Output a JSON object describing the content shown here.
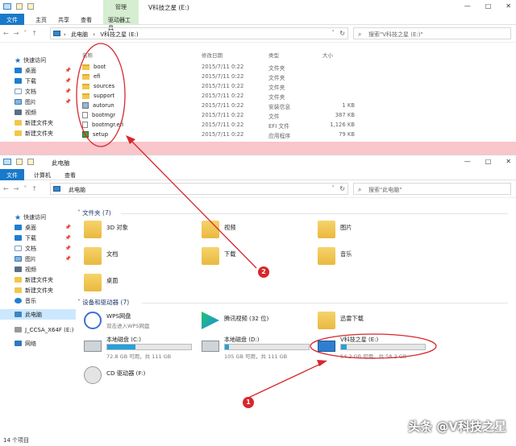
{
  "window1": {
    "context_tab": "管理",
    "title": "V科技之星 (E:)",
    "ribbon": {
      "file": "文件",
      "home": "主页",
      "share": "共享",
      "view": "查看",
      "drive_tools": "驱动器工具"
    },
    "address": {
      "pc": "此电脑",
      "sep": "›",
      "drive": "V科技之星 (E:)"
    },
    "search_placeholder": "搜索\"V科技之星 (E:)\"",
    "sidebar": [
      {
        "label": "快速访问",
        "icon": "star-icon"
      },
      {
        "label": "桌面",
        "icon": "desktop-icon",
        "pinned": true
      },
      {
        "label": "下载",
        "icon": "download-icon",
        "pinned": true
      },
      {
        "label": "文档",
        "icon": "documents-icon",
        "pinned": true
      },
      {
        "label": "图片",
        "icon": "pictures-icon",
        "pinned": true
      },
      {
        "label": "视频",
        "icon": "videos-icon"
      },
      {
        "label": "新建文件夹",
        "icon": "folder-icon"
      },
      {
        "label": "新建文件夹",
        "icon": "folder-icon"
      }
    ],
    "columns": {
      "name": "名称",
      "date": "修改日期",
      "type": "类型",
      "size": "大小"
    },
    "files": [
      {
        "name": "boot",
        "date": "2015/7/11 0:22",
        "type": "文件夹",
        "size": "",
        "icon": "folder"
      },
      {
        "name": "efi",
        "date": "2015/7/11 0:22",
        "type": "文件夹",
        "size": "",
        "icon": "folder"
      },
      {
        "name": "sources",
        "date": "2015/7/11 0:22",
        "type": "文件夹",
        "size": "",
        "icon": "folder"
      },
      {
        "name": "support",
        "date": "2015/7/11 0:22",
        "type": "文件夹",
        "size": "",
        "icon": "folder"
      },
      {
        "name": "autorun",
        "date": "2015/7/11 0:22",
        "type": "安装信息",
        "size": "1 KB",
        "icon": "gear"
      },
      {
        "name": "bootmgr",
        "date": "2015/7/11 0:22",
        "type": "文件",
        "size": "387 KB",
        "icon": "file"
      },
      {
        "name": "bootmgr.efi",
        "date": "2015/7/11 0:22",
        "type": "EFI 文件",
        "size": "1,126 KB",
        "icon": "file"
      },
      {
        "name": "setup",
        "date": "2015/7/11 0:22",
        "type": "应用程序",
        "size": "79 KB",
        "icon": "setup"
      }
    ]
  },
  "window2": {
    "title": "此电脑",
    "ribbon": {
      "file": "文件",
      "computer": "计算机",
      "view": "查看"
    },
    "address": {
      "pc": "此电脑"
    },
    "search_placeholder": "搜索\"此电脑\"",
    "sidebar": [
      {
        "label": "快速访问",
        "icon": "star-icon"
      },
      {
        "label": "桌面",
        "icon": "desktop-icon",
        "pinned": true
      },
      {
        "label": "下载",
        "icon": "download-icon",
        "pinned": true
      },
      {
        "label": "文档",
        "icon": "documents-icon",
        "pinned": true
      },
      {
        "label": "图片",
        "icon": "pictures-icon",
        "pinned": true
      },
      {
        "label": "视频",
        "icon": "videos-icon"
      },
      {
        "label": "新建文件夹",
        "icon": "folder-icon"
      },
      {
        "label": "新建文件夹",
        "icon": "folder-icon"
      },
      {
        "label": "音乐",
        "icon": "music-icon"
      },
      {
        "label": "此电脑",
        "icon": "pc-icon",
        "selected": true
      },
      {
        "label": "J_CCSA_X64F (E:)",
        "icon": "drive-icon"
      },
      {
        "label": "网络",
        "icon": "network-icon"
      }
    ],
    "folders_header": "文件夹 (7)",
    "folders": [
      "3D 对象",
      "视频",
      "图片",
      "文档",
      "下载",
      "音乐",
      "桌面"
    ],
    "devices_header": "设备和驱动器 (7)",
    "apps": [
      "WPS网盘",
      "腾讯视频 (32 位)",
      "迅雷下载"
    ],
    "wps_subtitle": "双击进入WPS网盘",
    "drives": [
      {
        "label": "本地磁盘 (C:)",
        "info": "72.8 GB 可用，共 111 GB",
        "used_fraction": 0.34
      },
      {
        "label": "本地磁盘 (D:)",
        "info": "105 GB 可用，共 111 GB",
        "used_fraction": 0.05
      },
      {
        "label": "V科技之星 (E:)",
        "info": "54.2 GB 可用，共 58.2 GB",
        "used_fraction": 0.07
      }
    ],
    "cd": "CD 驱动器 (F:)",
    "status": "14 个项目"
  },
  "annotations": {
    "badge1": "1",
    "badge2": "2"
  },
  "watermark": "头条 @V科技之星",
  "colors": {
    "accent": "#1979ca",
    "annotation": "#d9262b",
    "highlight": "#cce8ff"
  }
}
